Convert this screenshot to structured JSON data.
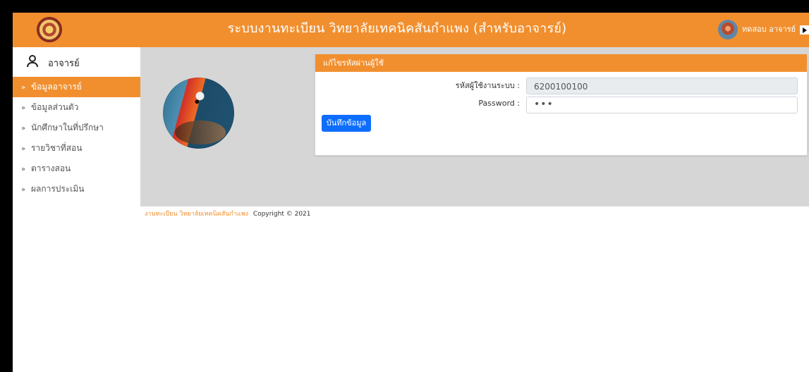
{
  "header": {
    "title": "ระบบงานทะเบียน วิทยาลัยเทคนิคสันกำแพง (สำหรับอาจารย์)",
    "user_name": "ทดสอบ อาจารย์",
    "logout_icon": "logout-icon",
    "logo_icon": "college-seal-icon",
    "avatar_icon": "user-avatar-icon"
  },
  "sidebar": {
    "title": "อาจารย์",
    "items": [
      {
        "label": "ข้อมูลอาจารย์",
        "active": true
      },
      {
        "label": "ข้อมูลส่วนตัว"
      },
      {
        "label": "นักศึกษาในที่ปรึกษา"
      },
      {
        "label": "รายวิชาที่สอน"
      },
      {
        "label": "ตารางสอน"
      },
      {
        "label": "ผลการประเมิน"
      }
    ]
  },
  "card": {
    "title": "แก้ไขรหัสผ่านผู้ใช้",
    "username_label": "รหัสผู้ใช้งานระบบ :",
    "username_value": "6200100100",
    "password_label": "Password :",
    "password_value": "•••",
    "save_label": "บันทึกข้อมูล"
  },
  "footer": {
    "link_text": "งานทะเบียน วิทยาลัยเทคนิคสันกำแพง",
    "copyright": "Copyright © 2021"
  },
  "colors": {
    "accent": "#f18f2e",
    "primary_button": "#0d6efd",
    "content_gray": "#d6d6d6"
  }
}
